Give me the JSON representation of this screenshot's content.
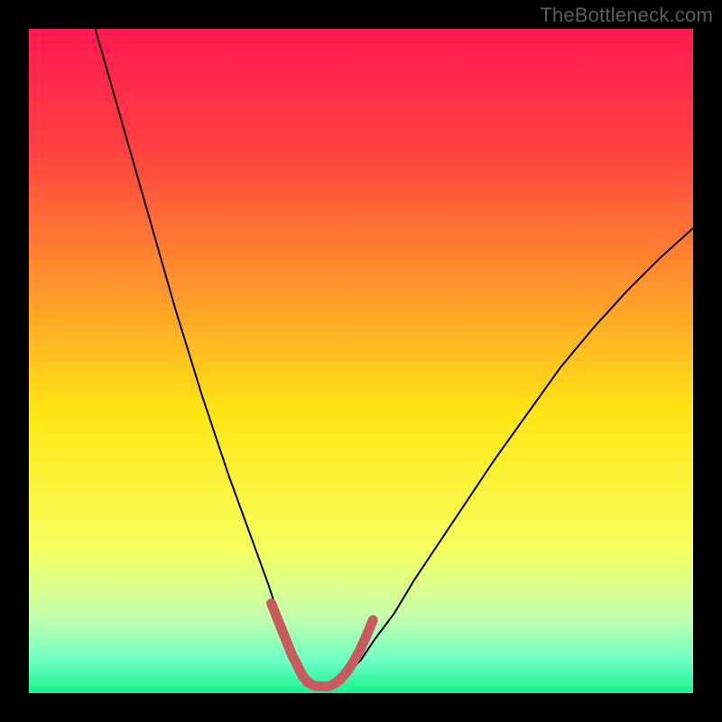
{
  "watermark": "TheBottleneck.com",
  "chart_data": {
    "type": "line",
    "title": "",
    "xlabel": "",
    "ylabel": "",
    "xlim": [
      0,
      100
    ],
    "ylim": [
      0,
      100
    ],
    "grid": false,
    "background_gradient": {
      "stops": [
        {
          "offset": 0.0,
          "color": "#ff1a52"
        },
        {
          "offset": 0.18,
          "color": "#ff4040"
        },
        {
          "offset": 0.4,
          "color": "#ff9a2a"
        },
        {
          "offset": 0.58,
          "color": "#ffe614"
        },
        {
          "offset": 0.78,
          "color": "#f6ff5c"
        },
        {
          "offset": 0.88,
          "color": "#c9ffab"
        },
        {
          "offset": 0.95,
          "color": "#6fffc4"
        },
        {
          "offset": 1.0,
          "color": "#18f28e"
        }
      ]
    },
    "series": [
      {
        "name": "bottleneck-curve",
        "stroke": "#000000",
        "stroke_width": 2,
        "x": [
          10,
          12,
          14,
          16,
          18,
          20,
          22,
          24,
          26,
          28,
          30,
          32,
          34,
          36,
          37,
          38,
          39,
          40,
          41,
          42,
          43,
          44,
          45,
          46,
          48,
          50,
          52,
          55,
          58,
          62,
          66,
          70,
          75,
          80,
          85,
          90,
          95,
          100
        ],
        "y": [
          100,
          93,
          86,
          79,
          72,
          65,
          58,
          51.5,
          45,
          39,
          33,
          27.5,
          22,
          16.5,
          13.5,
          11,
          8.5,
          6,
          4,
          2.5,
          1.5,
          1,
          1,
          1.5,
          3,
          5,
          8,
          12,
          17,
          23,
          29,
          35,
          42,
          49,
          55,
          60.5,
          65.5,
          70
        ]
      },
      {
        "name": "highlight-band",
        "stroke": "#c95a5e",
        "stroke_width": 11,
        "linecap": "round",
        "x": [
          36.5,
          37.5,
          38.5,
          39.5,
          40.5,
          41.2,
          42.0,
          43.0,
          44.0,
          45.0,
          46.0,
          47.0,
          48.0,
          48.8,
          49.8,
          50.8,
          51.8
        ],
        "y": [
          13.5,
          11.0,
          8.5,
          6.0,
          4.0,
          2.6,
          1.6,
          1.1,
          1.0,
          1.0,
          1.4,
          2.2,
          3.4,
          4.6,
          6.4,
          8.6,
          11.0
        ]
      }
    ]
  }
}
